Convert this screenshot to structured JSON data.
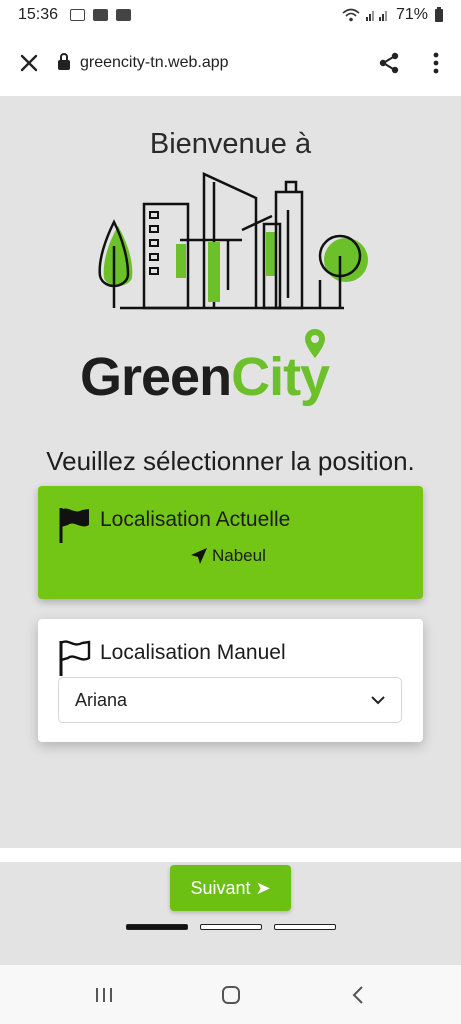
{
  "status_bar": {
    "time": "15:36",
    "battery": "71%"
  },
  "browser": {
    "url": "greencity-tn.web.app"
  },
  "page": {
    "welcome": "Bienvenue à",
    "brand_dark": "Green",
    "brand_green": "City",
    "prompt": "Veuillez sélectionner la position."
  },
  "current_location": {
    "title": "Localisation Actuelle",
    "place": "Nabeul"
  },
  "manual_location": {
    "title": "Localisation Manuel",
    "selected": "Ariana"
  },
  "footer": {
    "next_label": "Suivant ➤"
  },
  "colors": {
    "brand_green": "#6cc02a",
    "card_green": "#73c615",
    "button_green": "#6cc014"
  },
  "icons": [
    "close-icon",
    "lock-icon",
    "share-icon",
    "more-vert-icon",
    "flag-filled-icon",
    "flag-outline-icon",
    "navigation-arrow-icon",
    "chevron-down-icon",
    "recent-apps-icon",
    "home-icon",
    "back-icon"
  ]
}
